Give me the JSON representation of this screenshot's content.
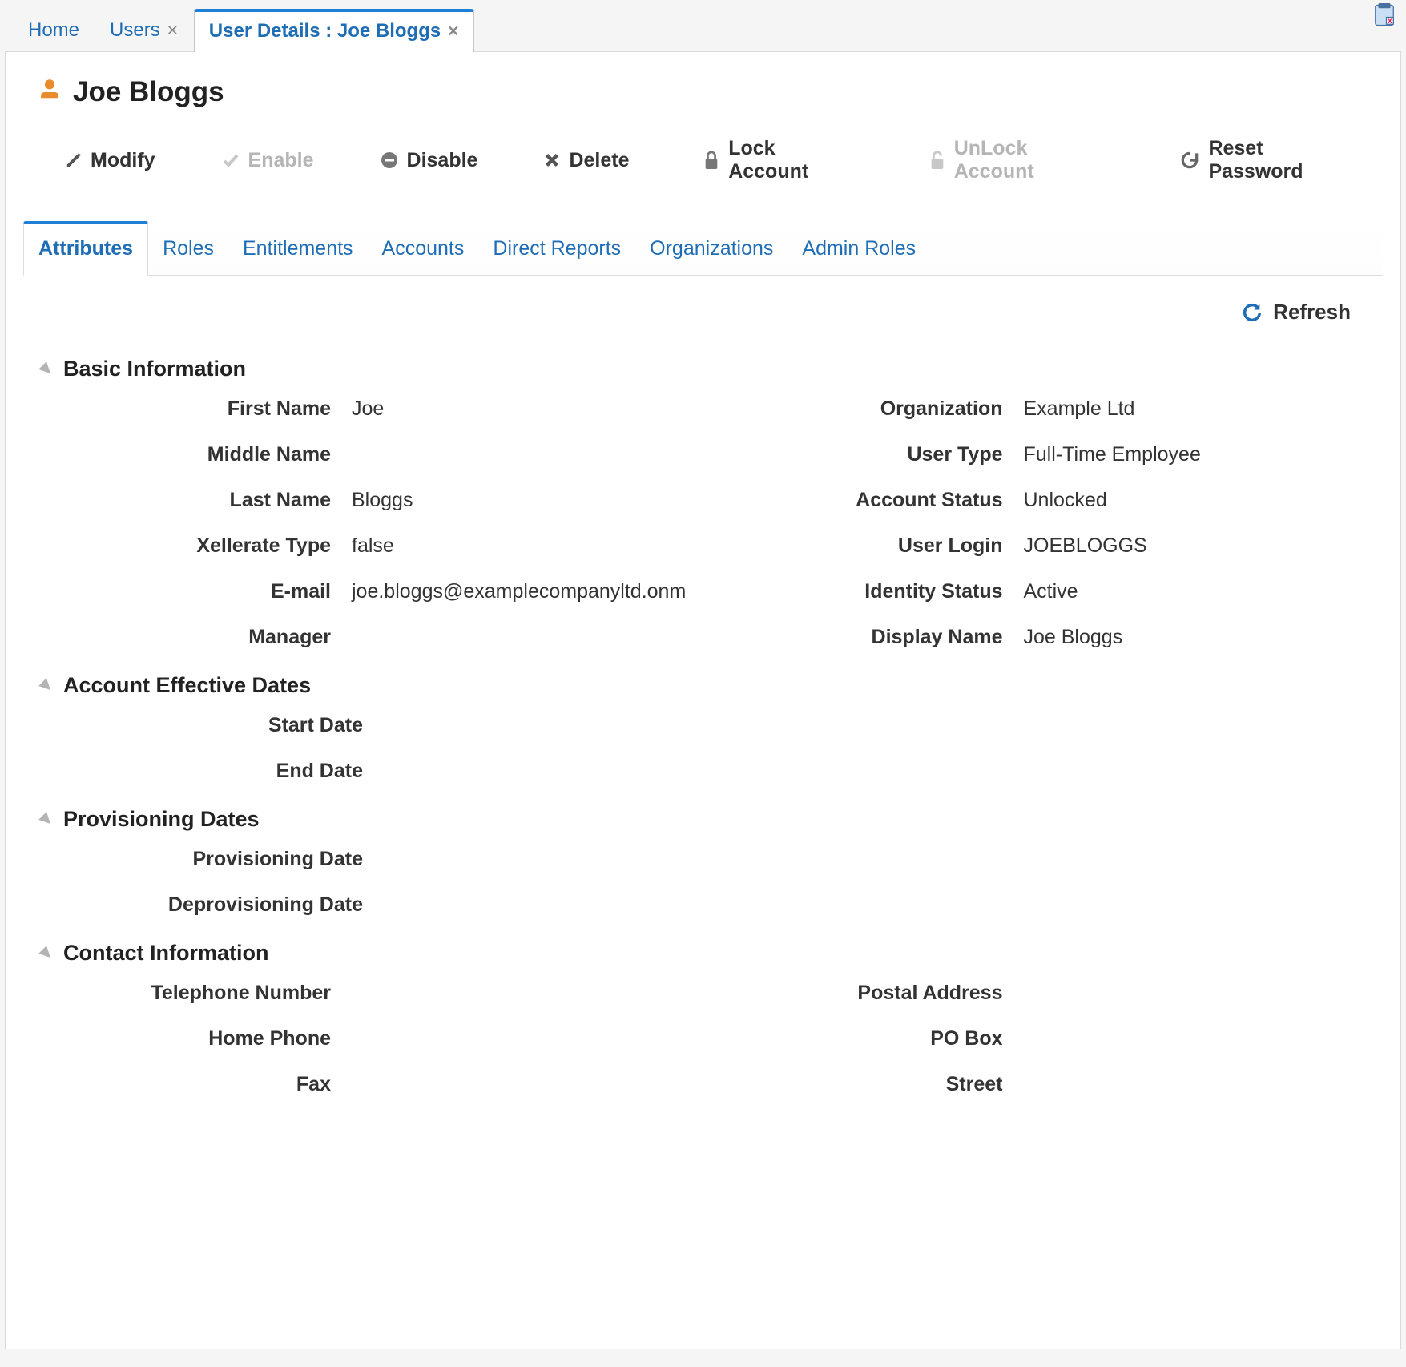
{
  "tabs": {
    "home": "Home",
    "users": "Users",
    "user_details": "User Details : Joe Bloggs"
  },
  "page_title": "Joe Bloggs",
  "toolbar": {
    "modify": "Modify",
    "enable": "Enable",
    "disable": "Disable",
    "delete": "Delete",
    "lock": "Lock Account",
    "unlock": "UnLock Account",
    "reset_password": "Reset Password"
  },
  "subtabs": {
    "attributes": "Attributes",
    "roles": "Roles",
    "entitlements": "Entitlements",
    "accounts": "Accounts",
    "direct_reports": "Direct Reports",
    "organizations": "Organizations",
    "admin_roles": "Admin Roles"
  },
  "refresh_label": "Refresh",
  "sections": {
    "basic_info": {
      "title": "Basic Information",
      "left": {
        "first_name": {
          "label": "First Name",
          "value": "Joe"
        },
        "middle_name": {
          "label": "Middle Name",
          "value": ""
        },
        "last_name": {
          "label": "Last Name",
          "value": "Bloggs"
        },
        "xellerate_type": {
          "label": "Xellerate Type",
          "value": "false"
        },
        "email": {
          "label": "E-mail",
          "value": "joe.bloggs@examplecompanyltd.onm"
        },
        "manager": {
          "label": "Manager",
          "value": ""
        }
      },
      "right": {
        "organization": {
          "label": "Organization",
          "value": "Example Ltd"
        },
        "user_type": {
          "label": "User Type",
          "value": "Full-Time Employee"
        },
        "account_status": {
          "label": "Account Status",
          "value": "Unlocked"
        },
        "user_login": {
          "label": "User Login",
          "value": "JOEBLOGGS"
        },
        "identity_status": {
          "label": "Identity Status",
          "value": "Active"
        },
        "display_name": {
          "label": "Display Name",
          "value": "Joe Bloggs"
        }
      }
    },
    "effective_dates": {
      "title": "Account Effective Dates",
      "start_date": {
        "label": "Start Date",
        "value": ""
      },
      "end_date": {
        "label": "End Date",
        "value": ""
      }
    },
    "provisioning_dates": {
      "title": "Provisioning Dates",
      "provisioning": {
        "label": "Provisioning Date",
        "value": ""
      },
      "deprovisioning": {
        "label": "Deprovisioning Date",
        "value": ""
      }
    },
    "contact_info": {
      "title": "Contact Information",
      "left": {
        "telephone": {
          "label": "Telephone Number",
          "value": ""
        },
        "home_phone": {
          "label": "Home Phone",
          "value": ""
        },
        "fax": {
          "label": "Fax",
          "value": ""
        }
      },
      "right": {
        "postal_address": {
          "label": "Postal Address",
          "value": ""
        },
        "po_box": {
          "label": "PO Box",
          "value": ""
        },
        "street": {
          "label": "Street",
          "value": ""
        }
      }
    }
  }
}
